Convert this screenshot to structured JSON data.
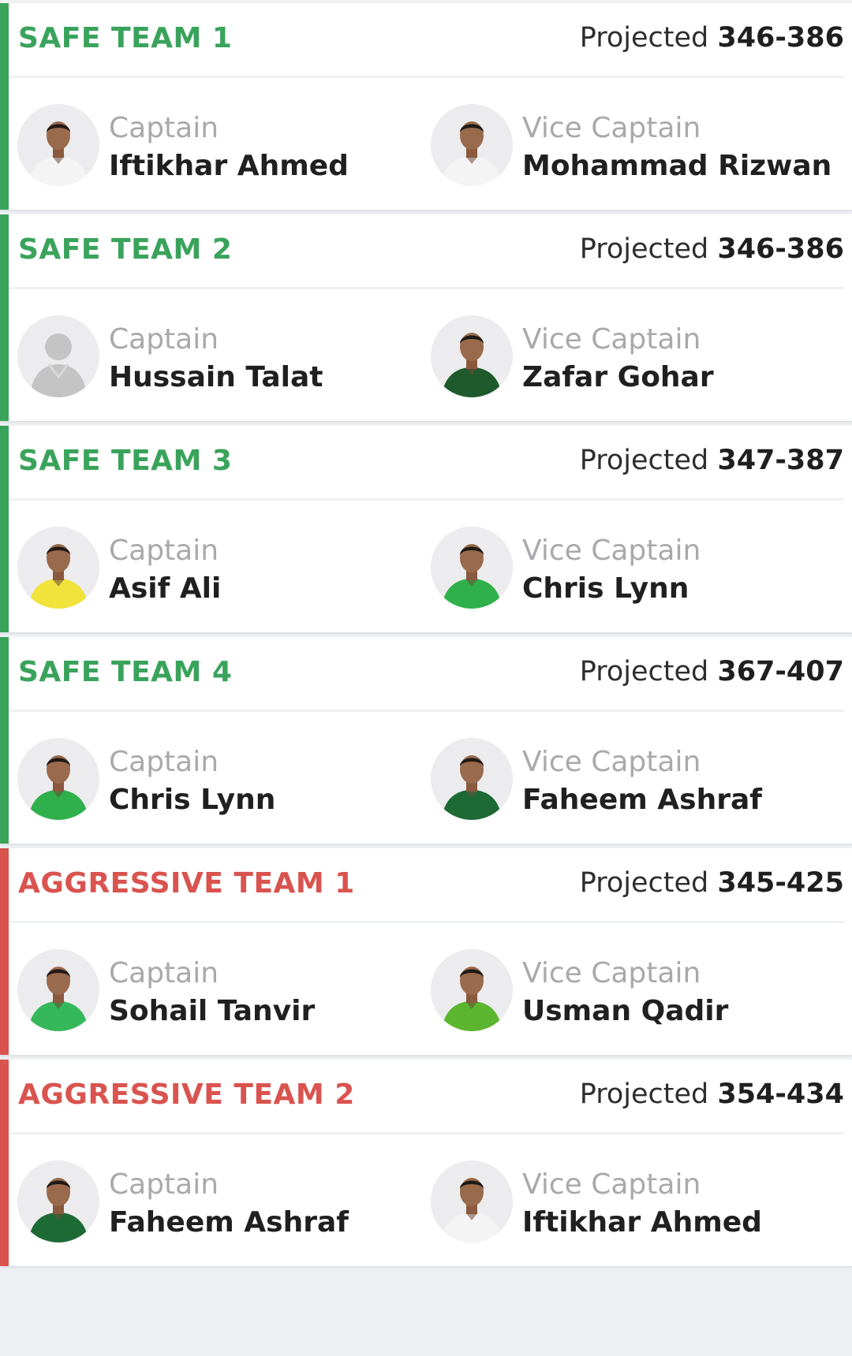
{
  "teams": [
    {
      "name": "SAFE TEAM 1",
      "kind": "safe",
      "projected_label": "Projected",
      "projected_range": "346-386",
      "captain": {
        "role": "Captain",
        "name": "Iftikhar Ahmed",
        "jersey_color": "#f4f4f4"
      },
      "vice_captain": {
        "role": "Vice Captain",
        "name": "Mohammad Rizwan",
        "jersey_color": "#f4f4f4"
      }
    },
    {
      "name": "SAFE TEAM 2",
      "kind": "safe",
      "projected_label": "Projected",
      "projected_range": "346-386",
      "captain": {
        "role": "Captain",
        "name": "Hussain Talat",
        "jersey_color": "#bdbdbd",
        "placeholder": true
      },
      "vice_captain": {
        "role": "Vice Captain",
        "name": "Zafar Gohar",
        "jersey_color": "#1e5a2b"
      }
    },
    {
      "name": "SAFE TEAM 3",
      "kind": "safe",
      "projected_label": "Projected",
      "projected_range": "347-387",
      "captain": {
        "role": "Captain",
        "name": "Asif Ali",
        "jersey_color": "#f1e33a"
      },
      "vice_captain": {
        "role": "Vice Captain",
        "name": "Chris Lynn",
        "jersey_color": "#2fb04a"
      }
    },
    {
      "name": "SAFE TEAM 4",
      "kind": "safe",
      "projected_label": "Projected",
      "projected_range": "367-407",
      "captain": {
        "role": "Captain",
        "name": "Chris Lynn",
        "jersey_color": "#2fb04a"
      },
      "vice_captain": {
        "role": "Vice Captain",
        "name": "Faheem Ashraf",
        "jersey_color": "#1e6a35"
      }
    },
    {
      "name": "AGGRESSIVE TEAM 1",
      "kind": "aggressive",
      "projected_label": "Projected",
      "projected_range": "345-425",
      "captain": {
        "role": "Captain",
        "name": "Sohail Tanvir",
        "jersey_color": "#35b85a"
      },
      "vice_captain": {
        "role": "Vice Captain",
        "name": "Usman Qadir",
        "jersey_color": "#5cb52f"
      }
    },
    {
      "name": "AGGRESSIVE TEAM 2",
      "kind": "aggressive",
      "projected_label": "Projected",
      "projected_range": "354-434",
      "captain": {
        "role": "Captain",
        "name": "Faheem Ashraf",
        "jersey_color": "#1e6a35"
      },
      "vice_captain": {
        "role": "Vice Captain",
        "name": "Iftikhar Ahmed",
        "jersey_color": "#f4f4f4"
      }
    }
  ],
  "colors": {
    "safe_accent": "#3aa35b",
    "aggressive_accent": "#d9534f",
    "role_text": "#a9a9ad",
    "name_text": "#202020",
    "page_background": "#eef0f3"
  },
  "icons": {
    "avatar": "player-avatar-icon",
    "placeholder": "player-silhouette-icon"
  }
}
